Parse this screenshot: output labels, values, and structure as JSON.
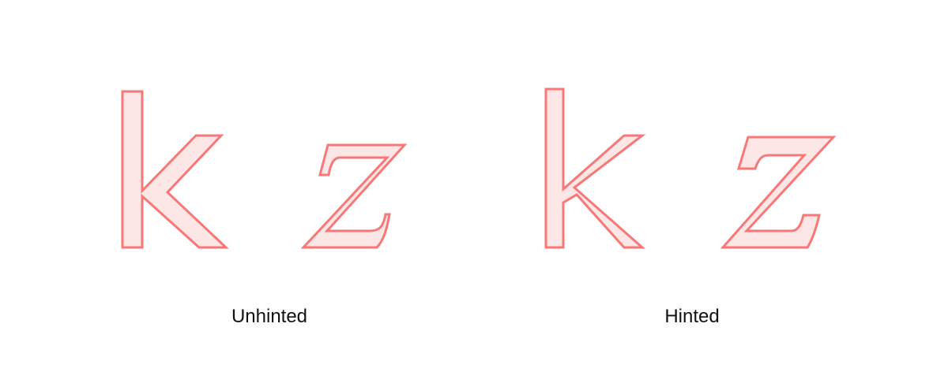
{
  "panels": {
    "unhinted": {
      "caption": "Unhinted"
    },
    "hinted": {
      "caption": "Hinted"
    }
  },
  "style": {
    "glyph_fill": "#fde6e6",
    "glyph_stroke": "#f87777"
  }
}
